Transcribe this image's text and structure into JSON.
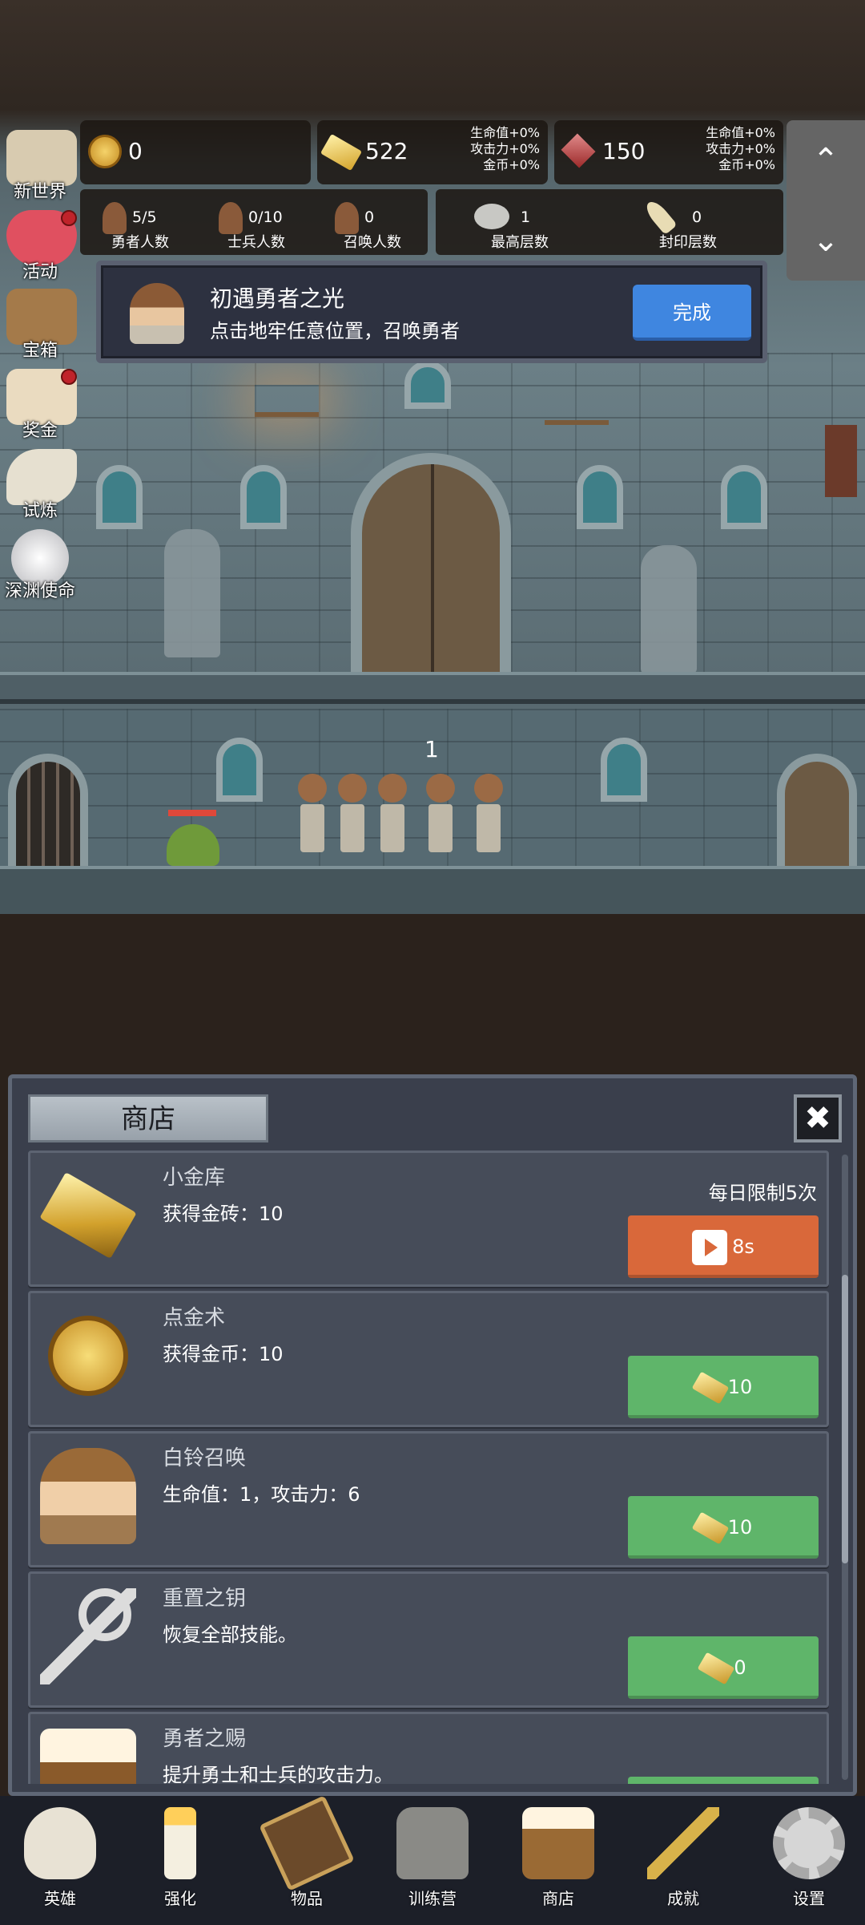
{
  "resources": {
    "gold_coin": "0",
    "gold_brick": "522",
    "gold_brick_bonus": [
      "生命值+0%",
      "攻击力+0%",
      "金币+0%"
    ],
    "gem": "150",
    "gem_bonus": [
      "生命值+0%",
      "攻击力+0%",
      "金币+0%"
    ]
  },
  "stats": {
    "hero_count": "5/5",
    "hero_label": "勇者人数",
    "soldier_count": "0/10",
    "soldier_label": "士兵人数",
    "summon_count": "0",
    "summon_label": "召唤人数",
    "max_floor": "1",
    "max_floor_label": "最高层数",
    "seal_floor": "0",
    "seal_floor_label": "封印层数"
  },
  "side_menu": [
    {
      "label": "新世界",
      "icon": "map-icon",
      "badge": false
    },
    {
      "label": "活动",
      "icon": "heart-icon",
      "badge": true
    },
    {
      "label": "宝箱",
      "icon": "chest-icon",
      "badge": false
    },
    {
      "label": "奖金",
      "icon": "envelope-icon",
      "badge": true
    },
    {
      "label": "试炼",
      "icon": "horn-icon",
      "badge": false
    },
    {
      "label": "深渊使命",
      "icon": "pearl-icon",
      "badge": false
    }
  ],
  "quest": {
    "title": "初遇勇者之光",
    "desc": "点击地牢任意位置，召唤勇者",
    "button": "完成"
  },
  "scene": {
    "wave": "1"
  },
  "shop": {
    "title": "商店",
    "items": [
      {
        "name": "小金库",
        "desc": "获得金砖：10",
        "limit": "每日限制5次",
        "price": "8s",
        "type": "ad"
      },
      {
        "name": "点金术",
        "desc": "获得金币：10",
        "limit": "",
        "price": "10",
        "type": "brick"
      },
      {
        "name": "白铃召唤",
        "desc": "生命值：1，攻击力：6",
        "limit": "",
        "price": "10",
        "type": "brick"
      },
      {
        "name": "重置之钥",
        "desc": "恢复全部技能。",
        "limit": "",
        "price": "0",
        "type": "brick"
      },
      {
        "name": "勇者之赐",
        "desc": "提升勇士和士兵的攻击力。",
        "limit": "",
        "price": "",
        "type": "brick"
      }
    ]
  },
  "nav": [
    {
      "label": "英雄",
      "icon": "skull-icon"
    },
    {
      "label": "强化",
      "icon": "candle-icon"
    },
    {
      "label": "物品",
      "icon": "book-icon"
    },
    {
      "label": "训练营",
      "icon": "lantern-icon"
    },
    {
      "label": "商店",
      "icon": "beer-mug-icon"
    },
    {
      "label": "成就",
      "icon": "key-icon"
    },
    {
      "label": "设置",
      "icon": "gear-icon"
    }
  ],
  "colors": {
    "confirm_blue": "#3f86e0",
    "buy_green": "#5fb56a",
    "ad_orange": "#d9683a",
    "badge_red": "#c0232a"
  }
}
